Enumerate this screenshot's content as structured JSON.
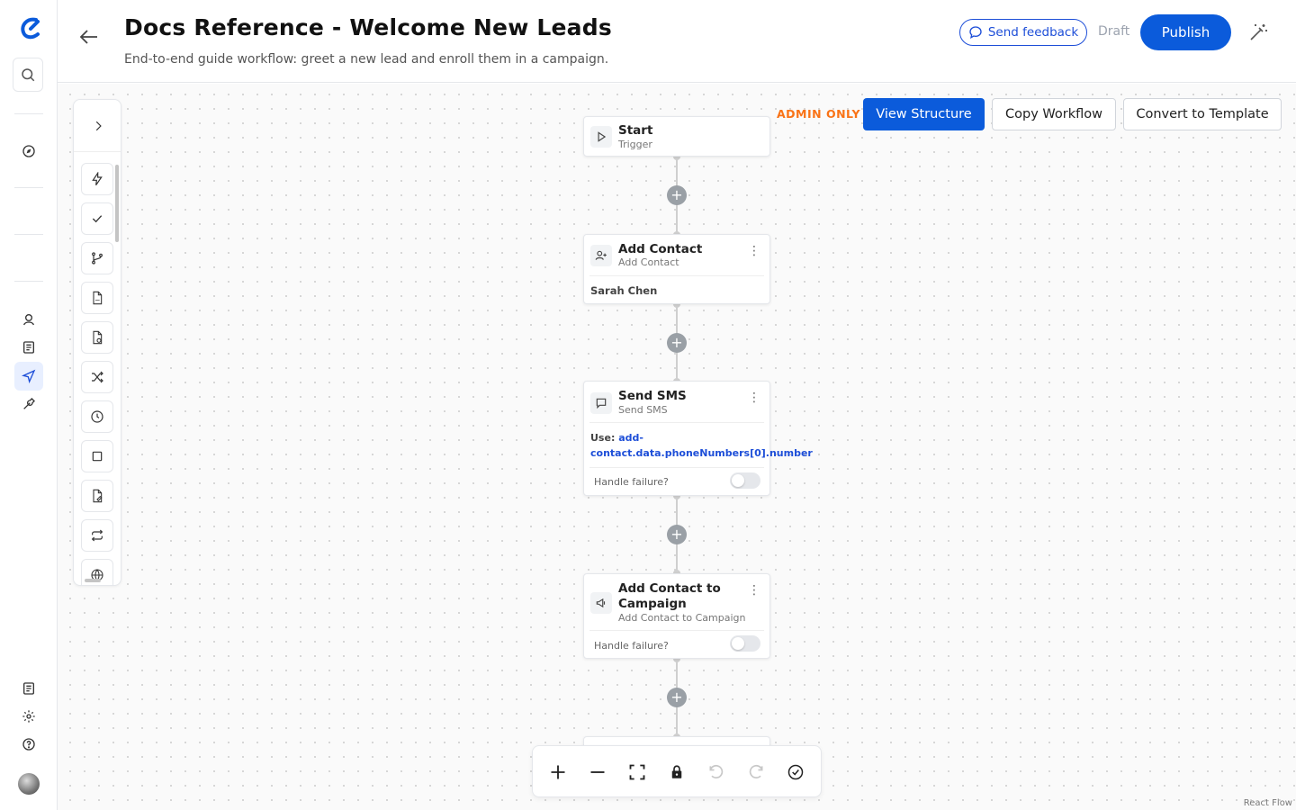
{
  "header": {
    "title": "Docs Reference - Welcome New Leads",
    "subtitle": "End-to-end guide workflow: greet a new lead and enroll them in a campaign.",
    "feedback_label": "Send feedback",
    "status": "Draft",
    "publish_label": "Publish"
  },
  "admin": {
    "badge": "ADMIN ONLY",
    "view_structure": "View Structure",
    "copy_workflow": "Copy Workflow",
    "convert_template": "Convert to Template"
  },
  "nodes": [
    {
      "title": "Start",
      "subtitle": "Trigger"
    },
    {
      "title": "Add Contact",
      "subtitle": "Add Contact",
      "value": "Sarah Chen"
    },
    {
      "title": "Send SMS",
      "subtitle": "Send SMS",
      "use_label": "Use:",
      "use_value": "add-contact.data.phoneNumbers[0].number",
      "handle_failure": "Handle failure?",
      "handle_failure_on": false
    },
    {
      "title": "Add Contact to Campaign",
      "subtitle": "Add Contact to Campaign",
      "handle_failure": "Handle failure?",
      "handle_failure_on": false
    }
  ],
  "plus_symbol": "+",
  "attribution": "React Flow",
  "colors": {
    "primary": "#0b5bdb",
    "admin": "#f97316",
    "link": "#1d4ed8"
  }
}
